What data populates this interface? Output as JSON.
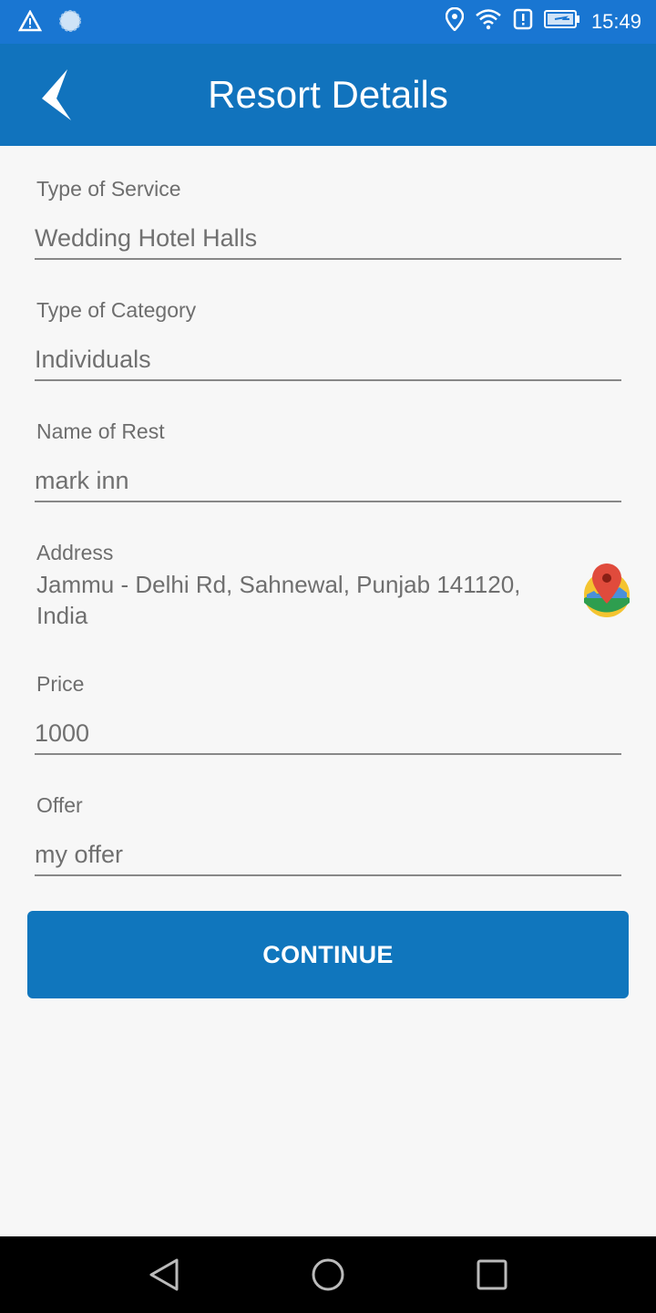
{
  "status_bar": {
    "time": "15:49",
    "icons": [
      "warning-icon",
      "loading-icon",
      "location-icon",
      "wifi-icon",
      "alert-icon",
      "battery-charging-icon"
    ]
  },
  "app_bar": {
    "title": "Resort Details",
    "back_icon": "chevron-left-icon"
  },
  "form": {
    "service": {
      "label": "Type of Service",
      "value": "Wedding Hotel Halls"
    },
    "category": {
      "label": "Type of Category",
      "value": "Individuals"
    },
    "name": {
      "label": "Name of Rest",
      "value": "mark inn"
    },
    "address": {
      "label": "Address",
      "value": "Jammu - Delhi Rd, Sahnewal, Punjab 141120, India",
      "icon": "map-pin-icon"
    },
    "price": {
      "label": "Price",
      "value": "1000"
    },
    "offer": {
      "label": "Offer",
      "value": "my offer"
    }
  },
  "continue_button": {
    "label": "CONTINUE"
  },
  "nav_bar": {
    "icons": [
      "back-triangle-icon",
      "home-circle-icon",
      "recents-square-icon"
    ]
  },
  "colors": {
    "status_bar": "#1976d2",
    "app_bar": "#1173bd",
    "button": "#1076bd",
    "background": "#f7f7f7"
  }
}
